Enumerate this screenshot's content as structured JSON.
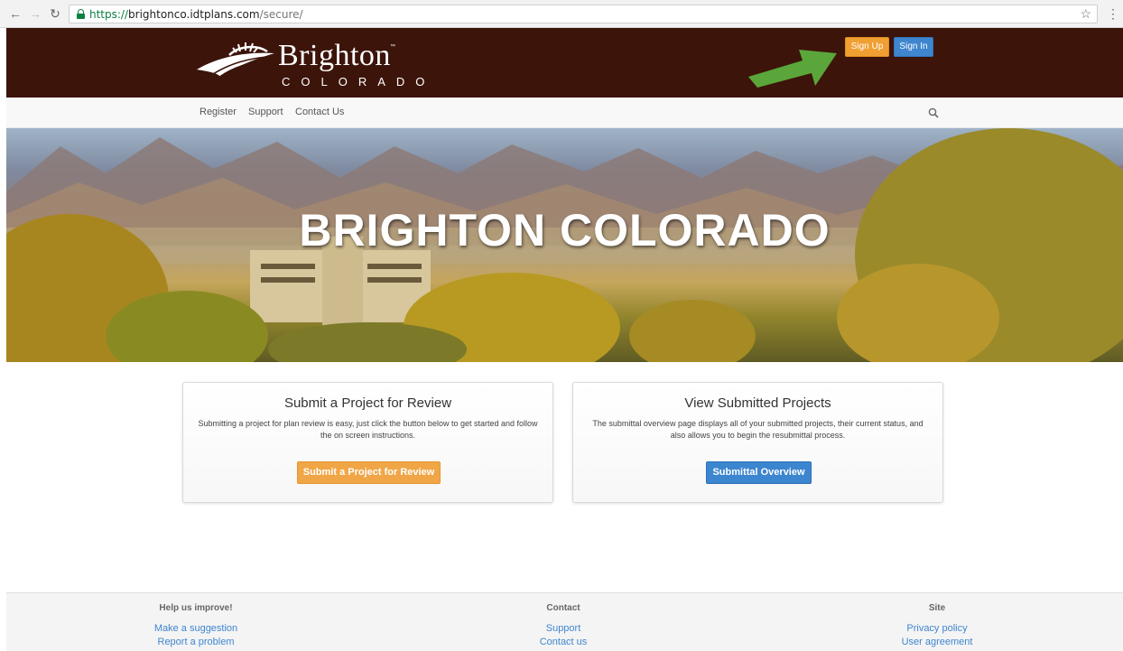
{
  "browser": {
    "url_scheme": "https://",
    "url_host": "brightonco.idtplans.com",
    "url_path": "/secure/"
  },
  "header": {
    "logo_word": "Brighton",
    "logo_tm": "™",
    "logo_sub": "COLORADO",
    "signup_label": "Sign Up",
    "signin_label": "Sign In",
    "colors": {
      "header_bg": "#3c140a",
      "signup": "#f0a033",
      "signin": "#3f86cf",
      "arrow": "#5aa63a"
    }
  },
  "nav": {
    "items": [
      {
        "label": "Register"
      },
      {
        "label": "Support"
      },
      {
        "label": "Contact Us"
      }
    ],
    "search_icon": "search-icon"
  },
  "hero": {
    "title": "BRIGHTON COLORADO"
  },
  "panels": [
    {
      "title": "Submit a Project for Review",
      "description": "Submitting a project for plan review is easy, just click the button below to get started and follow the on screen instructions.",
      "button_label": "Submit a Project for Review"
    },
    {
      "title": "View Submitted Projects",
      "description": "The submittal overview page displays all of your submitted projects, their current status, and also allows you to begin the resubmittal process.",
      "button_label": "Submittal Overview"
    }
  ],
  "footer": {
    "columns": [
      {
        "heading": "Help us improve!",
        "links": [
          "Make a suggestion",
          "Report a problem"
        ]
      },
      {
        "heading": "Contact",
        "links": [
          "Support",
          "Contact us"
        ]
      },
      {
        "heading": "Site",
        "links": [
          "Privacy policy",
          "User agreement"
        ]
      }
    ]
  }
}
